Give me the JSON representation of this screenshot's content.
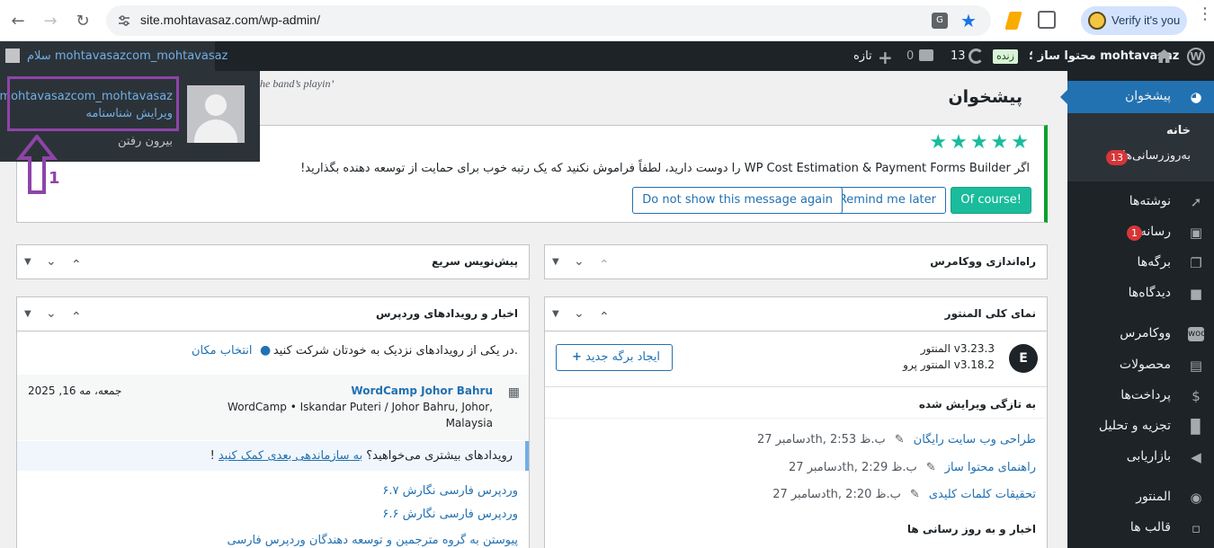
{
  "browser": {
    "url": "site.mohtavasaz.com/wp-admin/",
    "profile_label": "Verify it's you"
  },
  "adminbar": {
    "site_name": "محتوا ساز ؛ mohtavasaz",
    "live_badge": "زنده",
    "updates_count": "13",
    "comments_count": "0",
    "new_label": "تازه",
    "greeting": "سلام mohtavasazcom_mohtavasaz"
  },
  "user_menu": {
    "username": "mohtavasazcom_mohtavasaz",
    "edit_profile": "ویرایش شناسنامه",
    "logout": "بیرون رفتن",
    "annotation_number": "1"
  },
  "sidebar": {
    "dashboard": "پیشخوان",
    "home": "خانه",
    "updates": "به‌روزرسانی‌ها",
    "updates_badge": "13",
    "posts": "نوشته‌ها",
    "media": "رسانه",
    "media_badge": "1",
    "pages": "برگه‌ها",
    "comments": "دیدگاه‌ها",
    "woocommerce": "ووکامرس",
    "products": "محصولات",
    "payments": "پرداخت‌ها",
    "analytics": "تجزیه و تحلیل",
    "marketing": "بازاریابی",
    "elementor": "المنتور",
    "templates": "قالب ها"
  },
  "main": {
    "band_quote": "he band’s playin’",
    "page_title": "پیشخوان",
    "notice": {
      "text": "اگر WP Cost Estimation & Payment Forms Builder را دوست دارید، لطفاً فراموش نکنید که یک رتبه خوب برای حمایت از توسعه دهنده بگذارید!",
      "btn_ofcourse": "Of course!",
      "btn_remind": "Remind me later",
      "btn_dismiss": "Do not show this message again"
    },
    "woo_setup": {
      "title": "راه‌اندازی ووکامرس"
    },
    "quick_draft": {
      "title": "پیش‌نویس سریع"
    },
    "elementor_overview": {
      "title": "نمای کلی المنتور",
      "version_line1": "المنتور v3.23.3",
      "version_line2": "المنتور پرو v3.18.2",
      "new_page_btn": "ایجاد برگه جدید",
      "recent_title": "به تازگی ویرایش شده",
      "recent": [
        {
          "title": "طراحی وب سایت رایگان",
          "date": "دسامبر 27th, 2:53 ب.ظ"
        },
        {
          "title": "راهنمای محتوا ساز",
          "date": "دسامبر 27th, 2:29 ب.ظ"
        },
        {
          "title": "تحقیقات کلمات کلیدی",
          "date": "دسامبر 27th, 2:20 ب.ظ"
        }
      ],
      "news_title": "اخبار و به روز رسانی ها"
    },
    "wp_events": {
      "title": "اخبار و رویدادهای وردپرس",
      "attend_text": "در یکی از رویدادهای نزدیک به خودتان شرکت کنید.",
      "select_location": "انتخاب مکان",
      "event_title": "WordCamp Johor Bahru",
      "event_location1": "WordCamp • Iskandar Puteri / Johor Bahru, Johor,",
      "event_location2": "Malaysia",
      "event_date": "جمعه، مه 16, 2025",
      "more_events_text": "رویدادهای بیشتری می‌خواهید؟",
      "more_events_link": "به سازماندهی بعدی کمک کنید",
      "more_events_end": "!",
      "news": [
        "وردپرس فارسی نگارش ۶.۷",
        "وردپرس فارسی نگارش ۶.۶",
        "پیوستن به گروه مترجمین و توسعه دهندگان وردپرس فارسی"
      ]
    }
  }
}
